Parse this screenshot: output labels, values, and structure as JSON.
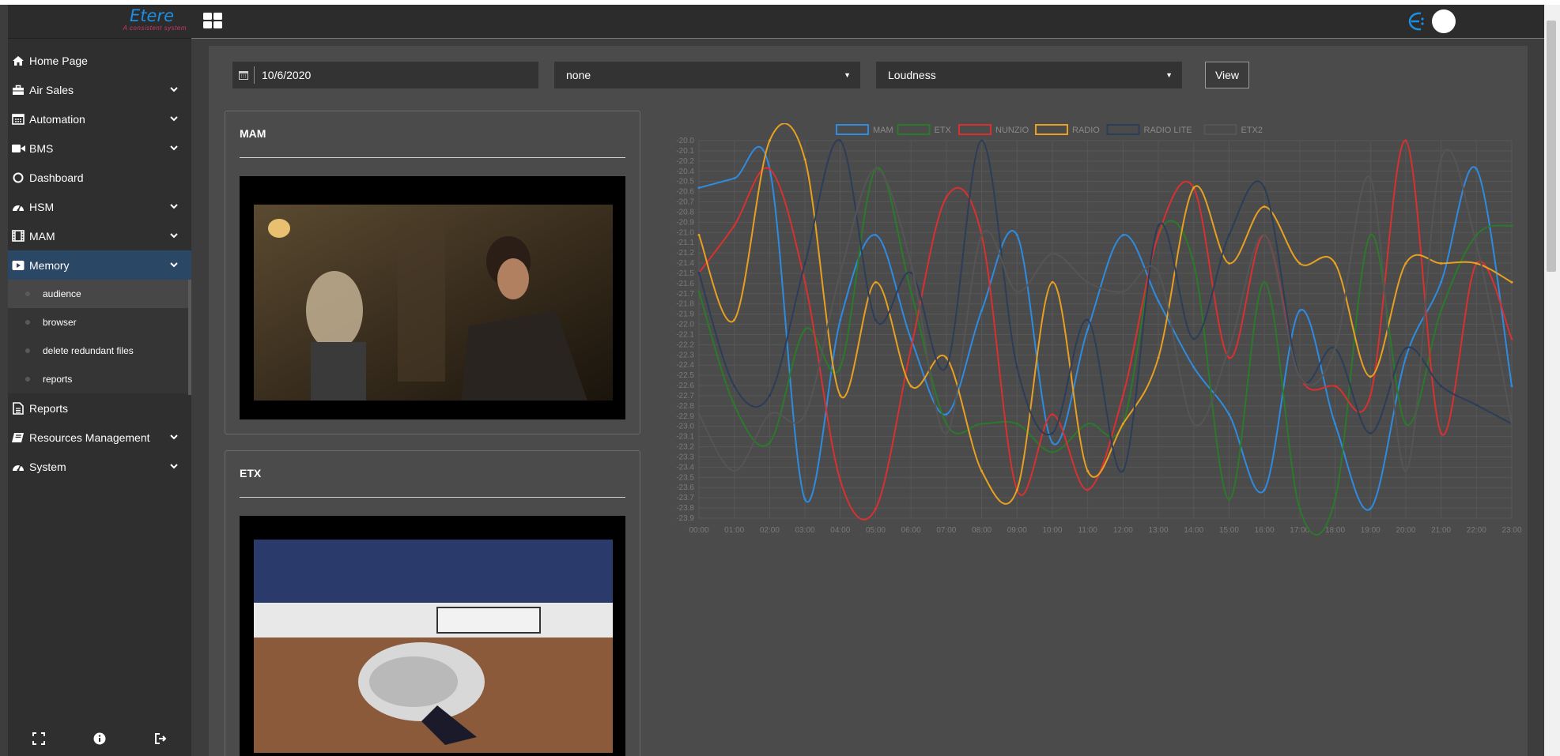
{
  "brand": {
    "title": "Etere",
    "subtitle": "A consistent system"
  },
  "sidebar": {
    "items": [
      {
        "label": "Home Page",
        "icon": "home-icon",
        "expandable": false
      },
      {
        "label": "Air Sales",
        "icon": "briefcase-icon",
        "expandable": true
      },
      {
        "label": "Automation",
        "icon": "calendar-icon",
        "expandable": true
      },
      {
        "label": "BMS",
        "icon": "video-camera-icon",
        "expandable": true
      },
      {
        "label": "Dashboard",
        "icon": "circle-icon",
        "expandable": false
      },
      {
        "label": "HSM",
        "icon": "gauge-icon",
        "expandable": true
      },
      {
        "label": "MAM",
        "icon": "film-icon",
        "expandable": true
      },
      {
        "label": "Memory",
        "icon": "play-icon",
        "expandable": true,
        "active": true
      },
      {
        "label": "Reports",
        "icon": "file-icon",
        "expandable": false
      },
      {
        "label": "Resources Management",
        "icon": "book-icon",
        "expandable": true
      },
      {
        "label": "System",
        "icon": "gauge-icon",
        "expandable": true
      }
    ],
    "memory_subitems": [
      {
        "label": "audience",
        "active": true
      },
      {
        "label": "browser"
      },
      {
        "label": "delete redundant files"
      },
      {
        "label": "reports"
      }
    ],
    "footer": [
      "expand-icon",
      "info-icon",
      "logout-icon"
    ]
  },
  "toolbar": {
    "date": "10/6/2020",
    "channel_select": "none",
    "metric_select": "Loudness",
    "view_label": "View"
  },
  "panels": [
    {
      "title": "MAM"
    },
    {
      "title": "ETX"
    }
  ],
  "chart_data": {
    "type": "line",
    "x": [
      "00:00",
      "01:00",
      "02:00",
      "03:00",
      "04:00",
      "05:00",
      "06:00",
      "07:00",
      "08:00",
      "09:00",
      "10:00",
      "11:00",
      "12:00",
      "13:00",
      "14:00",
      "15:00",
      "16:00",
      "17:00",
      "18:00",
      "19:00",
      "20:00",
      "21:00",
      "22:00",
      "23:00"
    ],
    "yticks": [
      "-20.0",
      "-20.1",
      "-20.2",
      "-20.4",
      "-20.5",
      "-20.6",
      "-20.7",
      "-20.8",
      "-20.9",
      "-21.0",
      "-21.1",
      "-21.2",
      "-21.4",
      "-21.5",
      "-21.6",
      "-21.7",
      "-21.8",
      "-21.9",
      "-22.0",
      "-22.1",
      "-22.2",
      "-22.3",
      "-22.4",
      "-22.5",
      "-22.6",
      "-22.7",
      "-22.8",
      "-22.9",
      "-23.0",
      "-23.1",
      "-23.2",
      "-23.3",
      "-23.4",
      "-23.5",
      "-23.6",
      "-23.7",
      "-23.8",
      "-23.9"
    ],
    "ylim": [
      -24.0,
      -20.0
    ],
    "legend_position": "top",
    "grid": true,
    "series": [
      {
        "name": "MAM",
        "color": "#2e8be0",
        "values": [
          -20.5,
          -20.4,
          -20.3,
          -23.8,
          -21.9,
          -21.0,
          -22.1,
          -22.9,
          -21.8,
          -21.0,
          -23.2,
          -22.0,
          -21.0,
          -21.7,
          -22.4,
          -22.9,
          -23.7,
          -21.8,
          -23.0,
          -23.9,
          -22.3,
          -21.5,
          -20.3,
          -22.6
        ]
      },
      {
        "name": "ETX",
        "color": "#2a7a2a",
        "values": [
          -21.6,
          -22.8,
          -23.2,
          -22.0,
          -22.4,
          -20.3,
          -21.6,
          -23.0,
          -23.0,
          -23.0,
          -23.3,
          -23.0,
          -23.0,
          -21.0,
          -21.3,
          -23.8,
          -21.5,
          -23.9,
          -23.8,
          -21.0,
          -23.0,
          -21.8,
          -21.0,
          -20.9
        ]
      },
      {
        "name": "NUNZIO",
        "color": "#d93030",
        "values": [
          -21.4,
          -20.9,
          -20.3,
          -21.5,
          -23.6,
          -23.9,
          -22.2,
          -20.6,
          -21.0,
          -23.7,
          -22.9,
          -23.7,
          -22.7,
          -21.0,
          -20.5,
          -22.3,
          -21.0,
          -22.5,
          -22.6,
          -22.7,
          -20.0,
          -23.1,
          -21.3,
          -22.1
        ]
      },
      {
        "name": "RADIO",
        "color": "#e8a020",
        "values": [
          -21.0,
          -21.9,
          -20.0,
          -20.2,
          -22.7,
          -21.5,
          -22.6,
          -22.3,
          -23.5,
          -23.7,
          -21.5,
          -23.5,
          -23.0,
          -22.3,
          -20.5,
          -21.3,
          -20.7,
          -21.3,
          -21.3,
          -22.5,
          -21.3,
          -21.3,
          -21.3,
          -21.5
        ]
      },
      {
        "name": "RADIO LITE",
        "color": "#2b3d58",
        "values": [
          -21.4,
          -22.6,
          -22.7,
          -21.3,
          -20.0,
          -21.9,
          -21.4,
          -22.4,
          -20.0,
          -22.4,
          -23.1,
          -21.9,
          -23.5,
          -20.9,
          -22.1,
          -21.0,
          -20.5,
          -22.5,
          -22.2,
          -23.1,
          -22.2,
          -22.6,
          -22.8,
          -23.0
        ]
      },
      {
        "name": "ETX2",
        "color": "#555555",
        "values": [
          -22.9,
          -23.5,
          -22.9,
          -22.9,
          -21.4,
          -20.3,
          -21.3,
          -23.1,
          -21.0,
          -21.6,
          -21.2,
          -21.5,
          -21.6,
          -21.4,
          -23.0,
          -22.2,
          -21.0,
          -22.5,
          -22.2,
          -20.4,
          -23.5,
          -20.2,
          -21.1,
          -23.0
        ]
      }
    ]
  }
}
